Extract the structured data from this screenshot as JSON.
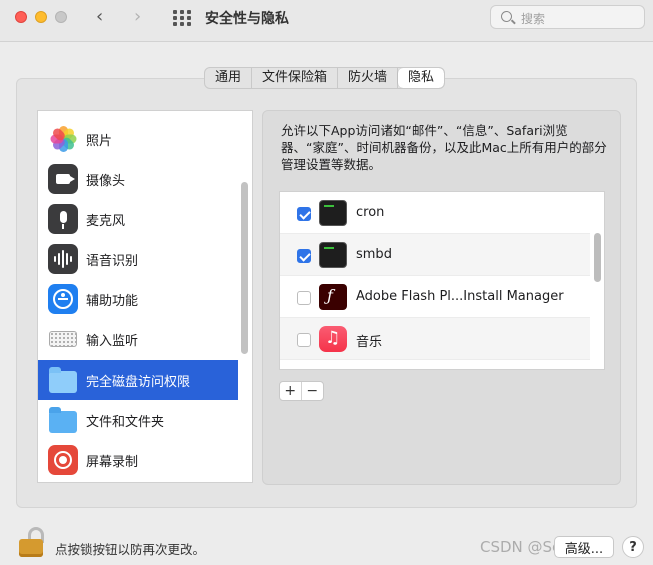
{
  "window": {
    "title": "安全性与隐私",
    "search_placeholder": "搜索"
  },
  "tabs": [
    {
      "label": "通用",
      "active": false
    },
    {
      "label": "文件保险箱",
      "active": false
    },
    {
      "label": "防火墙",
      "active": false
    },
    {
      "label": "隐私",
      "active": true
    }
  ],
  "categories": [
    {
      "label": "照片",
      "icon": "photos-icon"
    },
    {
      "label": "摄像头",
      "icon": "camera-icon"
    },
    {
      "label": "麦克风",
      "icon": "microphone-icon"
    },
    {
      "label": "语音识别",
      "icon": "speech-recognition-icon"
    },
    {
      "label": "辅助功能",
      "icon": "accessibility-icon"
    },
    {
      "label": "输入监听",
      "icon": "keyboard-icon"
    },
    {
      "label": "完全磁盘访问权限",
      "icon": "folder-icon",
      "selected": true
    },
    {
      "label": "文件和文件夹",
      "icon": "folder-icon"
    },
    {
      "label": "屏幕录制",
      "icon": "screen-recording-icon"
    }
  ],
  "description": "允许以下App访问诸如“邮件”、“信息”、Safari浏览器、“家庭”、时间机器备份，以及此Mac上所有用户的部分管理设置等数据。",
  "apps": [
    {
      "name": "cron",
      "checked": true,
      "icon": "terminal-icon"
    },
    {
      "name": "smbd",
      "checked": true,
      "icon": "terminal-icon"
    },
    {
      "name": "Adobe Flash Pl...Install Manager",
      "checked": false,
      "icon": "flash-icon"
    },
    {
      "name": "音乐",
      "checked": false,
      "icon": "music-icon"
    }
  ],
  "buttons": {
    "add": "+",
    "remove": "−",
    "advanced": "高级...",
    "help": "?"
  },
  "lock_text": "点按锁按钮以防再次更改。",
  "watermark": "CSDN @SeeAaron"
}
